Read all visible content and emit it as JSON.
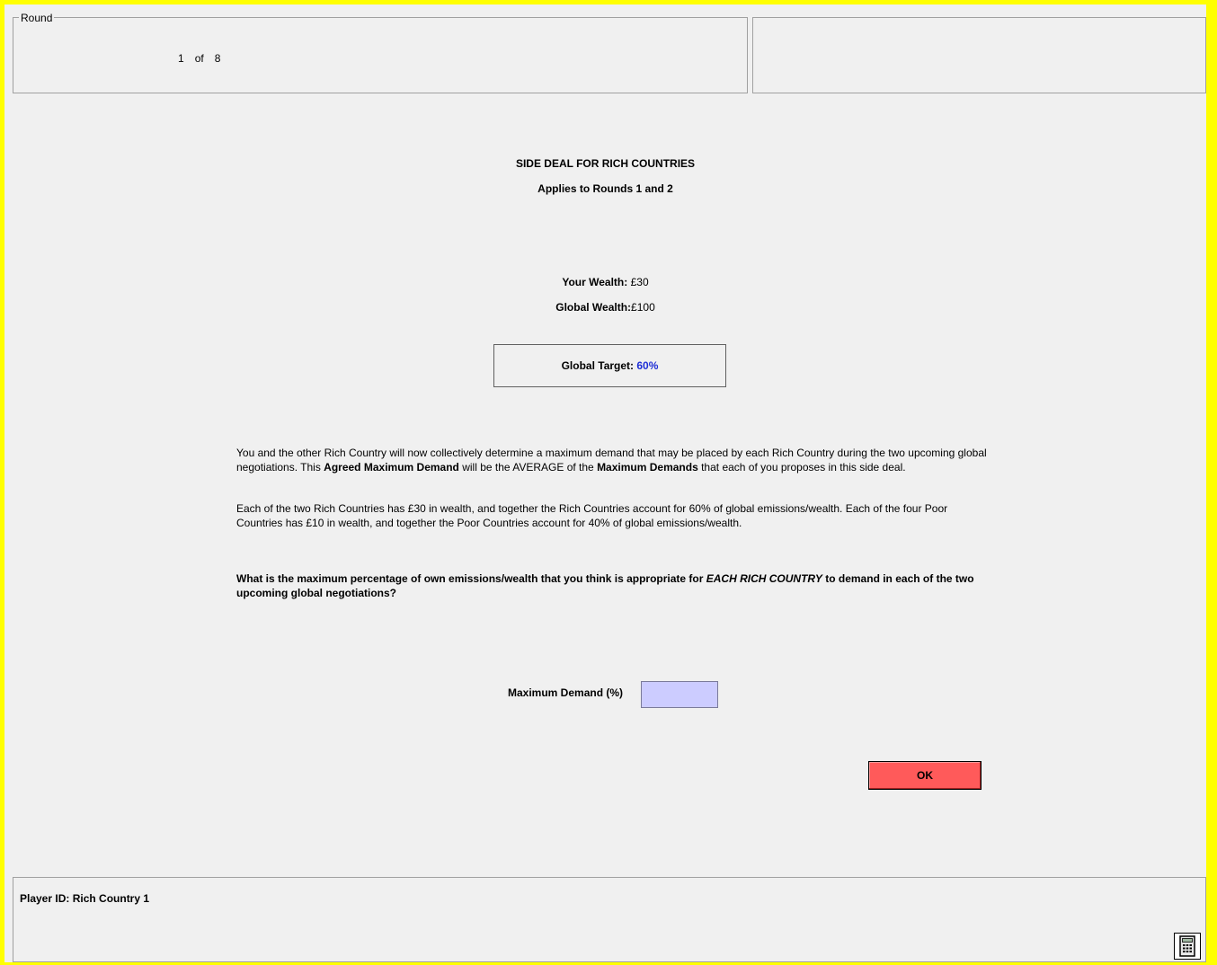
{
  "round": {
    "legend": "Round",
    "current": "1",
    "of_label": "of",
    "total": "8"
  },
  "main": {
    "title": "SIDE DEAL FOR RICH COUNTRIES",
    "subtitle": "Applies to Rounds 1 and 2",
    "wealth_label": "Your Wealth:",
    "wealth_value": "£30",
    "global_wealth_label": "Global Wealth:",
    "global_wealth_value": "£100",
    "target_label": "Global Target:",
    "target_value": "60%",
    "para1": {
      "t1": " You and the other Rich Country will now collectively determine a maximum demand that may be placed by each Rich Country during the two upcoming  global negotiations.  This ",
      "b1": "Agreed Maximum Demand",
      "t2": " will be the AVERAGE of the  ",
      "b2": "Maximum Demands",
      "t3": " that each of you proposes in this side deal."
    },
    "para2": "Each of the two Rich Countries has £30 in wealth, and together the Rich Countries account for 60% of global emissions/wealth.  Each of the four Poor Countries has £10 in wealth, and together the Poor Countries account for 40% of global emissions/wealth.",
    "question": {
      "t1": " What is the maximum percentage of own emissions/wealth that you think is appropriate for ",
      "em": "EACH RICH COUNTRY",
      "t2": " to demand in each of the two upcoming global negotiations?"
    },
    "demand_label": "Maximum Demand (%)",
    "demand_value": "",
    "ok_label": "OK"
  },
  "footer": {
    "player_id": "Player ID: Rich Country 1"
  },
  "icons": {
    "calculator": "calculator-icon"
  },
  "colors": {
    "frame": "#ffff00",
    "target_value": "#1f2fd6",
    "ok_button": "#ff5a5a",
    "input_bg": "#ccccff"
  }
}
